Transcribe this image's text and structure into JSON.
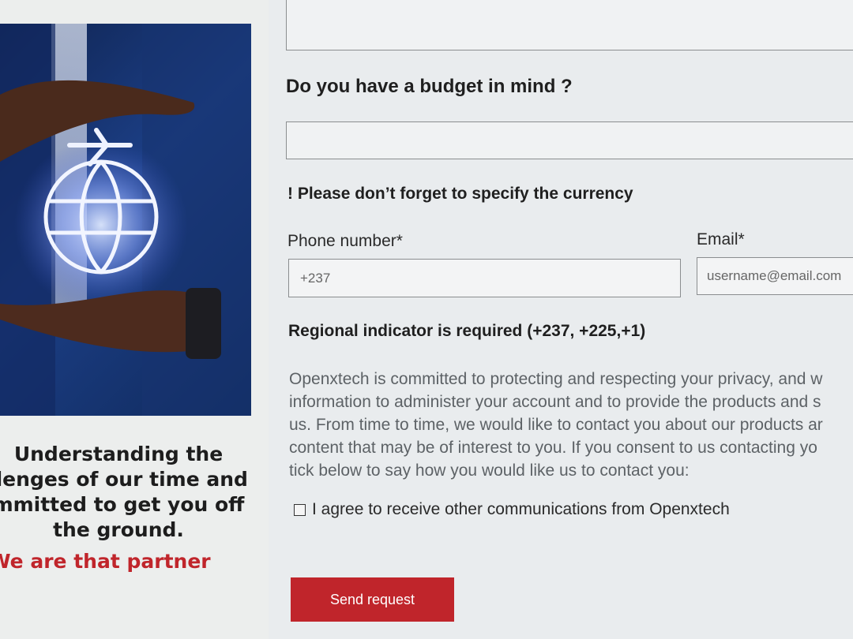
{
  "sidebar": {
    "tagline_lines": [
      "Understanding the",
      "llenges of our time and",
      "mmitted to get you off",
      "the ground."
    ],
    "partner_text": "We are that partner"
  },
  "form": {
    "budget_label": "Do you have a budget in mind ?",
    "currency_note": "! Please don’t forget to specify the currency",
    "phone_label": "Phone number*",
    "phone_placeholder": "+237",
    "email_label": "Email*",
    "email_placeholder": "username@email.com",
    "regional_note": "Regional indicator is required (+237, +225,+1)",
    "privacy_lines": [
      "Openxtech is committed to protecting and respecting your privacy, and w",
      "information to administer your account and to provide the products and s",
      "us. From time to time, we would like to contact you about our products ar",
      "content that may be of interest to you. If you consent to us contacting yo",
      "tick below to say how you would like us to contact you:"
    ],
    "consent_label": "I agree to receive other communications from Openxtech",
    "consent_checked": false,
    "submit_label": "Send request"
  },
  "colors": {
    "accent": "#c0252b",
    "hero_blue": "#1c3f86",
    "page_bg": "#e9ecee"
  },
  "icons": {
    "hero": [
      "airplane-icon",
      "globe-icon"
    ],
    "checkbox": "checkbox-icon"
  }
}
